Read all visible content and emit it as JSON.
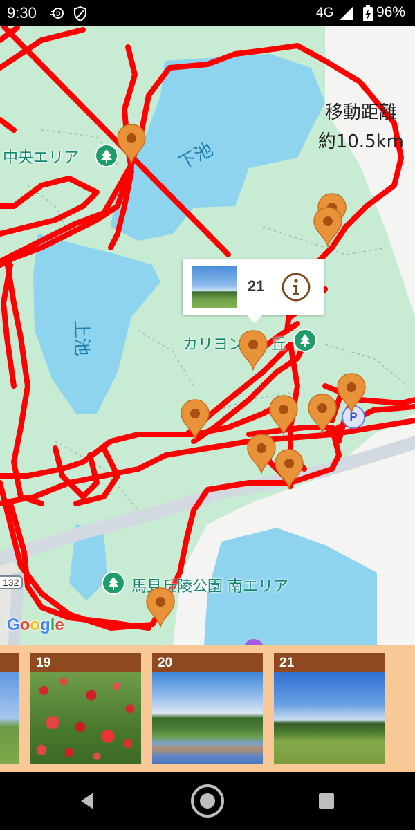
{
  "status_bar": {
    "time": "9:30",
    "network": "4G",
    "battery": "96%",
    "icons": [
      "data-saver-icon",
      "shield-icon",
      "signal-icon",
      "battery-charging-icon"
    ]
  },
  "map": {
    "distance_line1": "移動距離",
    "distance_line2": "約10.5km",
    "area_labels": {
      "central": "中央エリア",
      "kariyone": "カリヨン",
      "kariyone_end": "丘",
      "south": "馬見丘陵公園 南エリア",
      "south_left_num": "132"
    },
    "water_labels": {
      "shimo_ike": "下池",
      "kami_ike": "上池"
    },
    "parking_label": "P",
    "google_logo": [
      "G",
      "o",
      "o",
      "g",
      "l",
      "e"
    ],
    "marker_color": "#e8933a",
    "route_color": "#ff0000"
  },
  "info_window": {
    "number": "21",
    "info_icon": "info-icon"
  },
  "photo_strip": {
    "cards": [
      {
        "number": "19",
        "scene": "red poppies"
      },
      {
        "number": "20",
        "scene": "park lawn with blue flowers"
      },
      {
        "number": "21",
        "scene": "green meadow under blue sky"
      }
    ]
  },
  "nav_bar": {
    "buttons": [
      "back-icon",
      "home-icon",
      "recents-icon"
    ]
  }
}
